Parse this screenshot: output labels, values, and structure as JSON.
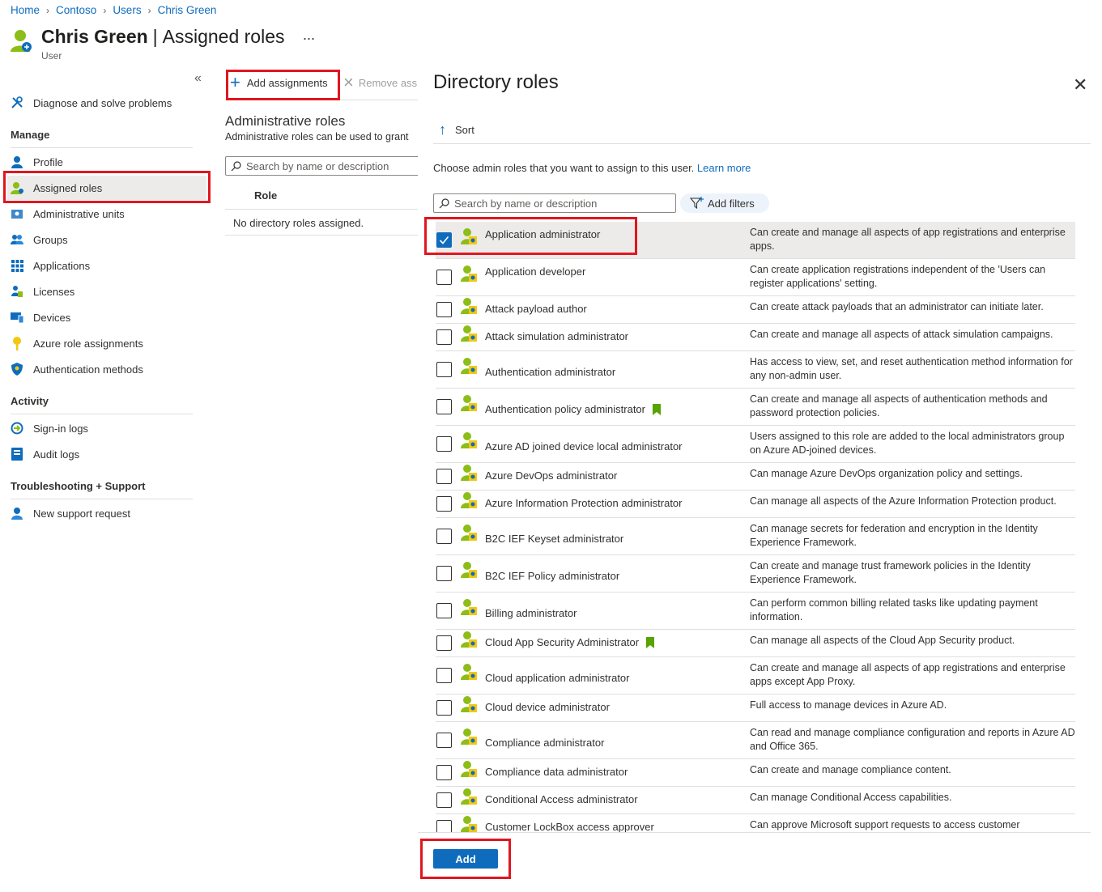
{
  "breadcrumb": {
    "items": [
      "Home",
      "Contoso",
      "Users",
      "Chris Green"
    ],
    "separator": ">"
  },
  "header": {
    "user_name": "Chris Green",
    "divider": "|",
    "page_name": "Assigned roles",
    "more": "...",
    "subtitle": "User"
  },
  "sidebar": {
    "collapse": "«",
    "top_item": {
      "label": "Diagnose and solve problems",
      "icon": "wrench-icon"
    },
    "sections": [
      {
        "title": "Manage"
      },
      {
        "title": "Activity"
      },
      {
        "title": "Troubleshooting + Support"
      }
    ],
    "manage_items": [
      {
        "label": "Profile",
        "icon": "person-icon"
      },
      {
        "label": "Assigned roles",
        "icon": "assigned-roles-icon"
      },
      {
        "label": "Administrative units",
        "icon": "admin-units-icon"
      },
      {
        "label": "Groups",
        "icon": "groups-icon"
      },
      {
        "label": "Applications",
        "icon": "applications-grid-icon"
      },
      {
        "label": "Licenses",
        "icon": "licenses-icon"
      },
      {
        "label": "Devices",
        "icon": "devices-icon"
      },
      {
        "label": "Azure role assignments",
        "icon": "key-icon"
      },
      {
        "label": "Authentication methods",
        "icon": "shield-icon"
      }
    ],
    "activity_items": [
      {
        "label": "Sign-in logs",
        "icon": "sign-in-logs-icon"
      },
      {
        "label": "Audit logs",
        "icon": "audit-logs-icon"
      }
    ],
    "support_items": [
      {
        "label": "New support request",
        "icon": "support-person-icon"
      }
    ],
    "selected": "Assigned roles"
  },
  "middle": {
    "add_label": "Add assignments",
    "remove_label": "Remove ass",
    "section_title": "Administrative roles",
    "section_desc": "Administrative roles can be used to grant",
    "search_placeholder": "Search by name or description",
    "column_header": "Role",
    "empty_text": "No directory roles assigned."
  },
  "directory_roles": {
    "title": "Directory roles",
    "close": "✕",
    "sort_label": "Sort",
    "help_text": "Choose admin roles that you want to assign to this user.",
    "learn_more": "Learn more",
    "search_placeholder": "Search by name or description",
    "filters_label": "Add filters",
    "add_button": "Add",
    "roles": [
      {
        "name": "Application administrator",
        "desc": "Can create and manage all aspects of app registrations and enterprise apps.",
        "checked": true,
        "flag": false
      },
      {
        "name": "Application developer",
        "desc": "Can create application registrations independent of the 'Users can register applications' setting.",
        "checked": false,
        "flag": false
      },
      {
        "name": "Attack payload author",
        "desc": "Can create attack payloads that an administrator can initiate later.",
        "checked": false,
        "flag": false
      },
      {
        "name": "Attack simulation administrator",
        "desc": "Can create and manage all aspects of attack simulation campaigns.",
        "checked": false,
        "flag": false
      },
      {
        "name": "Authentication administrator",
        "desc": "Has access to view, set, and reset authentication method information for any non-admin user.",
        "checked": false,
        "flag": false
      },
      {
        "name": "Authentication policy administrator",
        "desc": "Can create and manage all aspects of authentication methods and password protection policies.",
        "checked": false,
        "flag": true
      },
      {
        "name": "Azure AD joined device local administrator",
        "desc": "Users assigned to this role are added to the local administrators group on Azure AD-joined devices.",
        "checked": false,
        "flag": false
      },
      {
        "name": "Azure DevOps administrator",
        "desc": "Can manage Azure DevOps organization policy and settings.",
        "checked": false,
        "flag": false
      },
      {
        "name": "Azure Information Protection administrator",
        "desc": "Can manage all aspects of the Azure Information Protection product.",
        "checked": false,
        "flag": false
      },
      {
        "name": "B2C IEF Keyset administrator",
        "desc": "Can manage secrets for federation and encryption in the Identity Experience Framework.",
        "checked": false,
        "flag": false
      },
      {
        "name": "B2C IEF Policy administrator",
        "desc": "Can create and manage trust framework policies in the Identity Experience Framework.",
        "checked": false,
        "flag": false
      },
      {
        "name": "Billing administrator",
        "desc": "Can perform common billing related tasks like updating payment information.",
        "checked": false,
        "flag": false
      },
      {
        "name": "Cloud App Security Administrator",
        "desc": "Can manage all aspects of the Cloud App Security product.",
        "checked": false,
        "flag": true
      },
      {
        "name": "Cloud application administrator",
        "desc": "Can create and manage all aspects of app registrations and enterprise apps except App Proxy.",
        "checked": false,
        "flag": false
      },
      {
        "name": "Cloud device administrator",
        "desc": "Full access to manage devices in Azure AD.",
        "checked": false,
        "flag": false
      },
      {
        "name": "Compliance administrator",
        "desc": "Can read and manage compliance configuration and reports in Azure AD and Office 365.",
        "checked": false,
        "flag": false
      },
      {
        "name": "Compliance data administrator",
        "desc": "Can create and manage compliance content.",
        "checked": false,
        "flag": false
      },
      {
        "name": "Conditional Access administrator",
        "desc": "Can manage Conditional Access capabilities.",
        "checked": false,
        "flag": false
      },
      {
        "name": "Customer LockBox access approver",
        "desc": "Can approve Microsoft support requests to access customer",
        "checked": false,
        "flag": false
      }
    ]
  },
  "colors": {
    "accent": "#0f6cbd",
    "highlight": "#e0161f",
    "selected_bg": "#edebe9",
    "role_icon_green": "#8cbd18",
    "role_icon_yellow": "#f2c811"
  }
}
